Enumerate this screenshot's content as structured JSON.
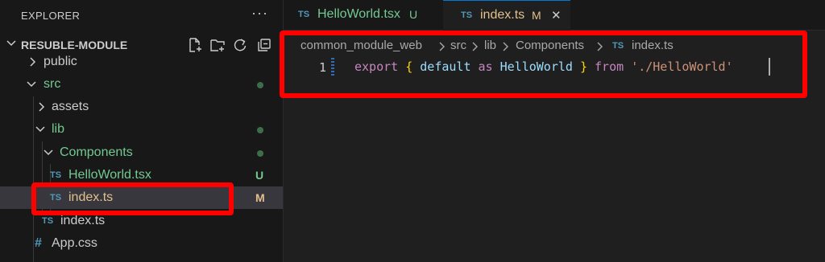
{
  "explorer": {
    "title": "EXPLORER",
    "more": "···",
    "section": "RESUBLE-MODULE",
    "tree": [
      {
        "label": "public",
        "kind": "folder",
        "expanded": false
      },
      {
        "label": "src",
        "kind": "folder",
        "expanded": true,
        "status": "dot"
      },
      {
        "label": "assets",
        "kind": "folder",
        "expanded": false
      },
      {
        "label": "lib",
        "kind": "folder",
        "expanded": true,
        "status": "dot"
      },
      {
        "label": "Components",
        "kind": "folder",
        "expanded": true,
        "status": "dot"
      },
      {
        "label": "HelloWorld.tsx",
        "kind": "ts",
        "icon": "TS",
        "status": "U"
      },
      {
        "label": "index.ts",
        "kind": "ts",
        "icon": "TS",
        "status": "M",
        "selected": true
      },
      {
        "label": "index.ts",
        "kind": "ts",
        "icon": "TS"
      },
      {
        "label": "App.css",
        "kind": "css",
        "icon": "#"
      }
    ]
  },
  "tabs": [
    {
      "icon": "TS",
      "name": "HelloWorld.tsx",
      "status": "U",
      "active": false
    },
    {
      "icon": "TS",
      "name": "index.ts",
      "status": "M",
      "active": true,
      "close": "✕"
    }
  ],
  "breadcrumb": [
    "common_module_web",
    "src",
    "lib",
    "Components",
    "TS",
    "index.ts"
  ],
  "editor": {
    "line_number": "1",
    "tokens": {
      "export": "export",
      "brace_open": "{",
      "default": "default",
      "as": "as",
      "name": "HelloWorld",
      "brace_close": "}",
      "from": "from",
      "path": "'./HelloWorld'"
    }
  },
  "colors": {
    "untracked": "#73c991",
    "modified": "#e2c08d",
    "ts_icon": "#519aba",
    "highlight": "#ff0000"
  }
}
